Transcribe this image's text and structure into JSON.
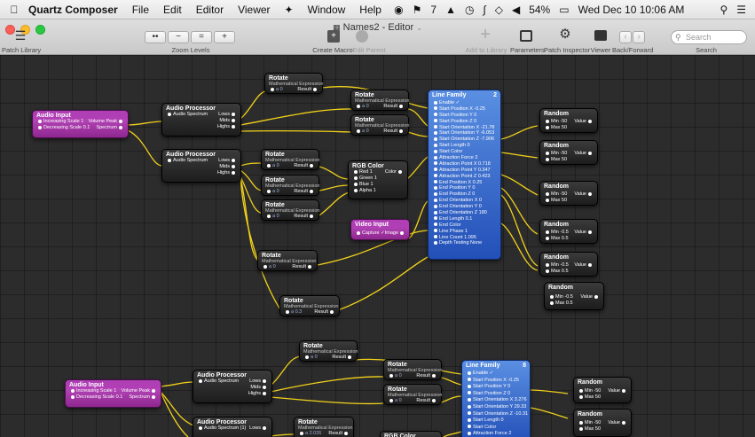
{
  "menubar": {
    "app_name": "Quartz Composer",
    "items": [
      "File",
      "Edit",
      "Editor",
      "Viewer",
      "Window",
      "Help"
    ],
    "status": {
      "seven": "7",
      "battery": "54%",
      "datetime": "Wed Dec 10 10:06 AM"
    }
  },
  "window": {
    "title": "Names2 - Editor",
    "patch_library_label": "Patch Library",
    "zoom_levels_label": "Zoom Levels",
    "zoom_buttons": [
      "••",
      "−",
      "=",
      "+"
    ],
    "create_macro_label": "Create Macro",
    "edit_parent_label": "Edit Parent",
    "add_to_library_label": "Add to Library",
    "parameters_label": "Parameters",
    "patch_inspector_label": "Patch Inspector",
    "viewer_label": "Viewer",
    "back_forward_label": "Back/Forward",
    "search_label": "Search",
    "search_placeholder": "Search"
  },
  "patches": {
    "audio_input": {
      "title": "Audio Input",
      "rows": [
        {
          "left": "Increasing Scale 1",
          "right": "Volume Peak"
        },
        {
          "left": "Decreasing Scale 0.1",
          "right": "Spectrum"
        }
      ]
    },
    "audio_input_2": {
      "title": "Audio Input",
      "rows": [
        {
          "left": "Increasing Scale 1",
          "right": "Volume Peak"
        },
        {
          "left": "Decreasing Scale 0.1",
          "right": "Spectrum"
        }
      ]
    },
    "audio_processor": {
      "title": "Audio Processor",
      "input": "Audio Spectrum",
      "outputs": [
        "Lows",
        "Mids",
        "Highs"
      ]
    },
    "audio_processor_bottom_input": "Audio Spectrum (1)",
    "rotate": {
      "title": "Rotate",
      "subtitle": "Mathematical Expression",
      "input": "a 0",
      "input_a03": "a 0.3",
      "input_a2026": "a 2.026",
      "output": "Result"
    },
    "rgb_color": {
      "title": "RGB Color",
      "inputs": [
        "Red 1",
        "Green 1",
        "Blue 1",
        "Alpha 1"
      ],
      "output": "Color"
    },
    "video_input": {
      "title": "Video Input",
      "input": "Capture ✓",
      "output": "Image"
    },
    "line_family": {
      "title": "Line Family",
      "count_badge": "2",
      "count_badge_2": "8",
      "params": [
        "Enable ✓",
        "Start Position X -0.25",
        "Start Position Y 0",
        "Start Position Z 0",
        "Start Orientation X -21.78",
        "Start Orientation Y -6.053",
        "Start Orientation Z -7.906",
        "Start Length 0",
        "Start Color",
        "Attraction Force 2",
        "Attraction Point X 0.718",
        "Attraction Point Y 0.347",
        "Attraction Point Z 0.423",
        "End Position X 0.25",
        "End Position Y 0",
        "End Position Z 0",
        "End Orientation X 0",
        "End Orientation Y 0",
        "End Orientation Z 180",
        "End Length 0.1",
        "End Color",
        "Line Phase 1",
        "Line Count 1.095",
        "Depth Testing None"
      ],
      "params_2": [
        "Enable ✓",
        "Start Position X -0.25",
        "Start Position Y 0",
        "Start Position Z 0",
        "Start Orientation X 3.276",
        "Start Orientation Y 29.33",
        "Start Orientation Z -10.31",
        "Start Length 0",
        "Start Color",
        "Attraction Force 2"
      ]
    },
    "random": {
      "title": "Random",
      "inputs": [
        {
          "min": "Min -50",
          "max": "Max 50"
        },
        {
          "min": "Min -50",
          "max": "Max 50"
        },
        {
          "min": "Min -50",
          "max": "Max 50"
        },
        {
          "min": "Min -0.5",
          "max": "Max 0.5"
        },
        {
          "min": "Min -0.5",
          "max": "Max 0.5"
        },
        {
          "min": "Min -0.5",
          "max": "Max 0.5"
        },
        {
          "min": "Min -50",
          "max": "Max 50"
        },
        {
          "min": "Min -50",
          "max": "Max 50"
        }
      ],
      "output": "Value"
    }
  },
  "colors": {
    "wire": "#f2d21a",
    "purple_patch": "#a83ab0",
    "blue_patch": "#3a6fd4",
    "dark_patch": "#2a2a2a"
  }
}
